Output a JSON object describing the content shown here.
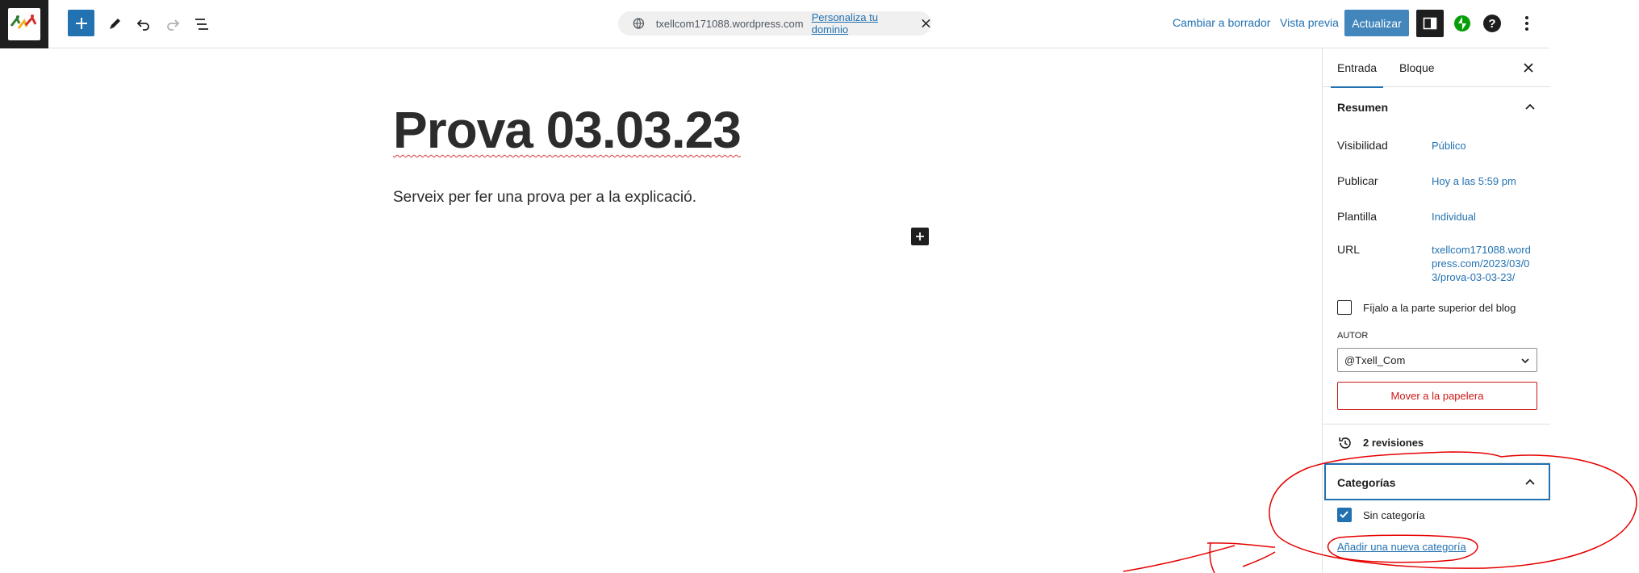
{
  "topbar": {
    "domain": "txellcom171088.wordpress.com",
    "customize_domain": "Personaliza tu dominio",
    "switch_draft": "Cambiar a borrador",
    "preview": "Vista previa",
    "update": "Actualizar",
    "help_glyph": "?"
  },
  "post": {
    "title": "Prova 03.03.23",
    "paragraph": "Serveix per fer una prova per a la explicació."
  },
  "sidebar": {
    "tabs": [
      "Entrada",
      "Bloque"
    ],
    "summary_title": "Resumen",
    "visibility_label": "Visibilidad",
    "visibility_value": "Público",
    "publish_label": "Publicar",
    "publish_value": "Hoy a las 5:59 pm",
    "template_label": "Plantilla",
    "template_value": "Individual",
    "url_label": "URL",
    "url_value_lines": [
      "txellcom171088.word",
      "press.com/2023/03/0",
      "3/prova-03-03-23/"
    ],
    "sticky_label": "Fíjalo a la parte superior del blog",
    "author_label": "AUTOR",
    "author_value": "@Txell_Com",
    "trash": "Mover a la papelera",
    "revisions": "2 revisiones",
    "categories_title": "Categorías",
    "category_item": "Sin categoría",
    "add_category": "Añadir una nueva categoría"
  },
  "icons": [
    "inserter-plus-icon",
    "pencil-icon",
    "undo-icon",
    "redo-icon",
    "list-view-icon",
    "globe-icon",
    "close-icon",
    "settings-panel-icon",
    "jetpack-icon",
    "help-icon",
    "more-options-icon",
    "chevron-up-icon",
    "chevron-down-icon",
    "history-icon",
    "check-icon"
  ],
  "colors": {
    "accent": "#2271b1",
    "annotation": "#e60000",
    "danger": "#cc1818"
  }
}
